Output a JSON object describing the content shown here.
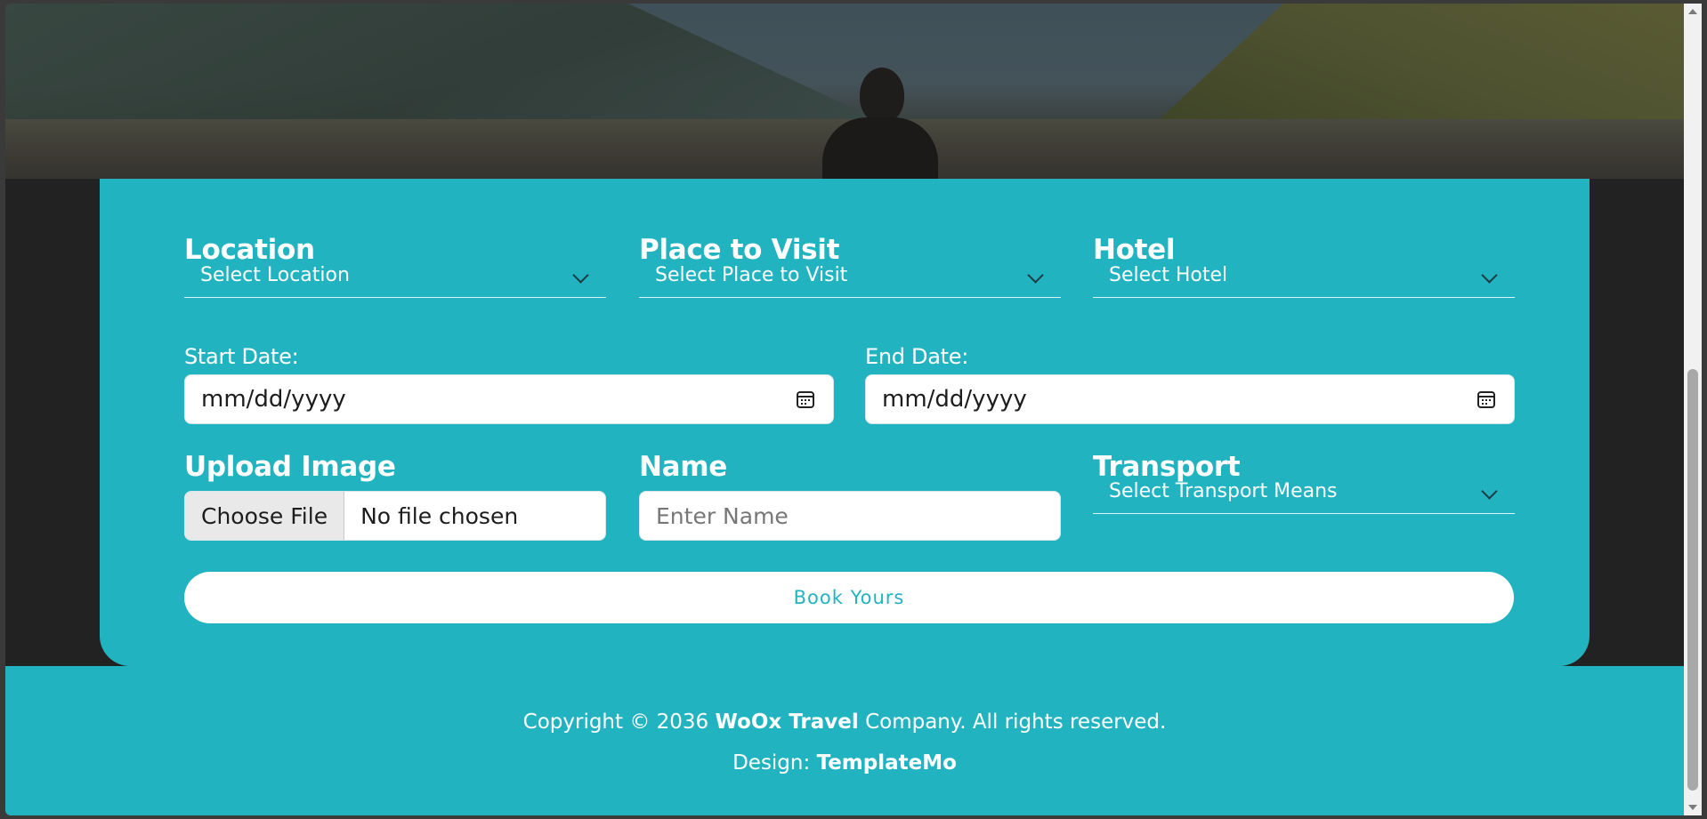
{
  "form": {
    "location": {
      "label": "Location",
      "placeholder": "Select Location"
    },
    "place": {
      "label": "Place to Visit",
      "placeholder": "Select Place to Visit"
    },
    "hotel": {
      "label": "Hotel",
      "placeholder": "Select Hotel"
    },
    "start_date": {
      "label": "Start Date:",
      "placeholder": "mm/dd/yyyy"
    },
    "end_date": {
      "label": "End Date:",
      "placeholder": "mm/dd/yyyy"
    },
    "upload": {
      "label": "Upload Image",
      "button": "Choose File",
      "status": "No file chosen"
    },
    "name": {
      "label": "Name",
      "placeholder": "Enter Name"
    },
    "transport": {
      "label": "Transport",
      "placeholder": "Select Transport Means"
    },
    "submit_label": "Book Yours"
  },
  "footer": {
    "copyright_prefix": "Copyright © 2036",
    "company": "WoOx Travel",
    "copyright_suffix": "Company. All rights reserved.",
    "design_prefix": "Design:",
    "designer": "TemplateMo"
  },
  "colors": {
    "accent": "#22b3c1",
    "background": "#222222"
  },
  "icons": {
    "calendar": "calendar-icon",
    "chevron": "chevron-down-icon"
  }
}
